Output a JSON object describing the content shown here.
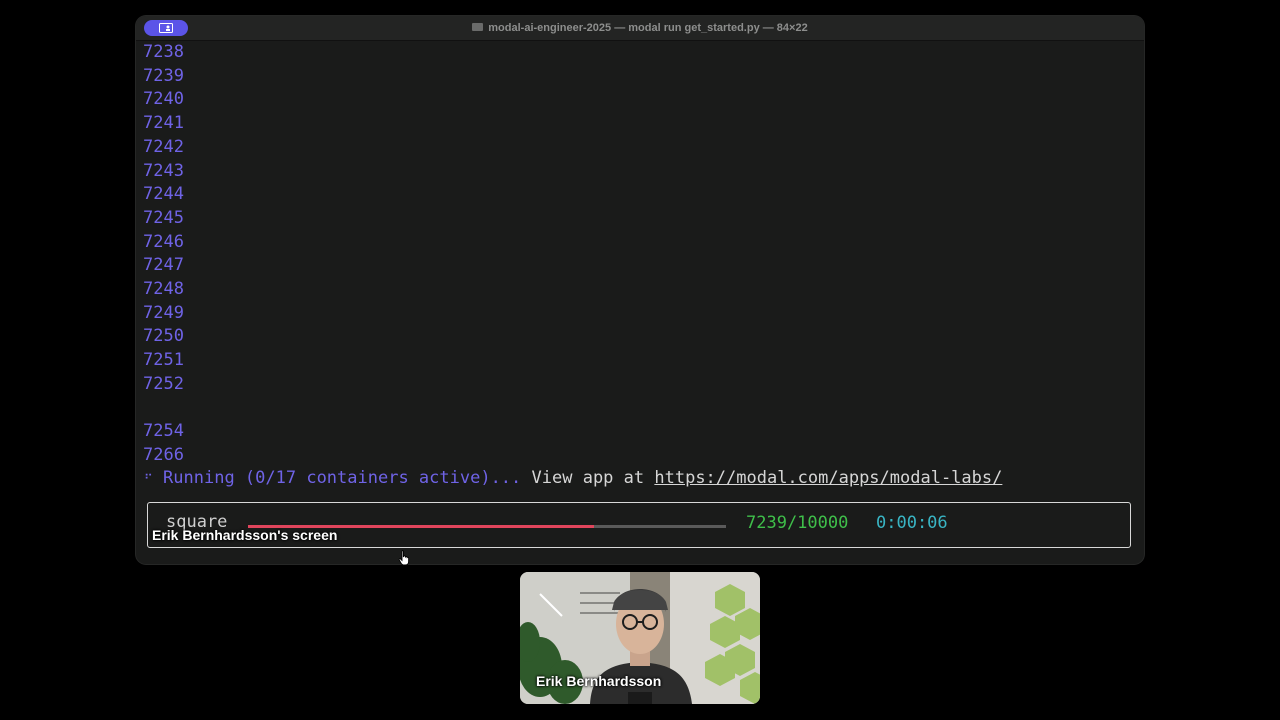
{
  "window": {
    "title": "modal-ai-engineer-2025 — modal run get_started.py — 84×22"
  },
  "terminal": {
    "lines": [
      {
        "text": "7238",
        "row": 0
      },
      {
        "text": "7239",
        "row": 1
      },
      {
        "text": "7240",
        "row": 2
      },
      {
        "text": "7241",
        "row": 3
      },
      {
        "text": "7242",
        "row": 4
      },
      {
        "text": "7243",
        "row": 5
      },
      {
        "text": "7244",
        "row": 6
      },
      {
        "text": "7245",
        "row": 7
      },
      {
        "text": "7246",
        "row": 8
      },
      {
        "text": "7247",
        "row": 9
      },
      {
        "text": "7248",
        "row": 10
      },
      {
        "text": "7249",
        "row": 11
      },
      {
        "text": "7250",
        "row": 12
      },
      {
        "text": "7251",
        "row": 13
      },
      {
        "text": "7252",
        "row": 14
      },
      {
        "text": "7254",
        "row": 16
      },
      {
        "text": "7266",
        "row": 17
      }
    ],
    "status": {
      "spinner": "⠋",
      "running": "Running (0/17 containers active)...",
      "view_prefix": "View app at",
      "url": "https://modal.com/apps/modal-labs/"
    },
    "progress": {
      "label": "square",
      "fraction": 0.7239,
      "count": "7239/10000",
      "elapsed": "0:00:06",
      "bar_color": "#e0455c"
    }
  },
  "screen_share": {
    "owner_label": "Erik Bernhardsson's screen"
  },
  "participant": {
    "name": "Erik Bernhardsson"
  },
  "colors": {
    "line_number": "#6f63e6",
    "count": "#3fbf4a",
    "time": "#39b5c4",
    "share_badge": "#5b54e8"
  }
}
